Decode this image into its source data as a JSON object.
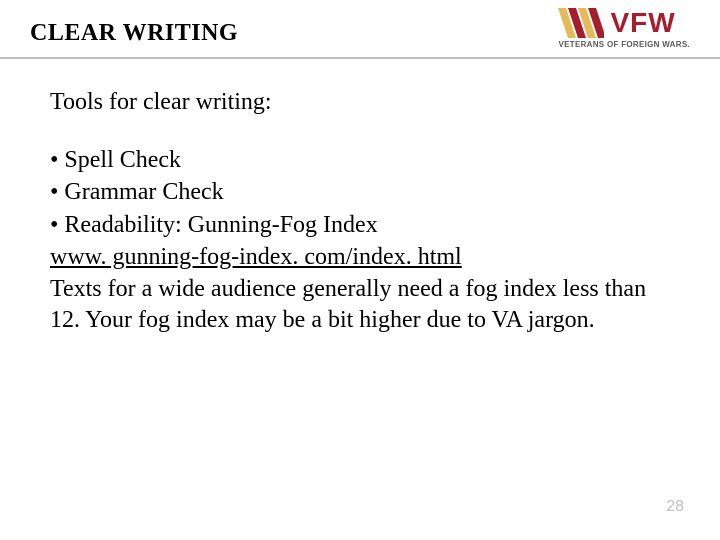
{
  "header": {
    "title": "CLEAR WRITING",
    "logo_text": "VFW",
    "logo_subtext": "VETERANS OF FOREIGN WARS."
  },
  "content": {
    "intro": "Tools for clear writing:",
    "bullets": [
      "Spell Check",
      "Grammar Check",
      "Readability: Gunning-Fog Index"
    ],
    "link_text": "www. gunning-fog-index. com/index. html",
    "body": "Texts for a wide audience generally need a fog index less than 12. Your fog index may be a bit higher due to VA jargon."
  },
  "page_number": "28"
}
